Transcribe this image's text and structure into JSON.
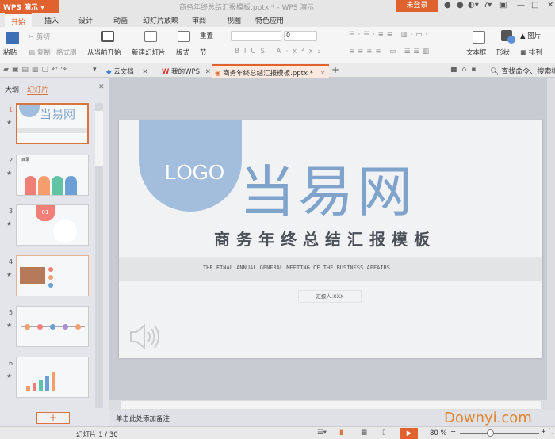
{
  "app": {
    "name": "WPS 演示",
    "doc_title": "商务年终总结汇报模板.pptx * - WPS 演示",
    "login": "未登录"
  },
  "menu_tabs": [
    "开始",
    "插入",
    "设计",
    "动画",
    "幻灯片放映",
    "审阅",
    "视图",
    "特色应用"
  ],
  "ribbon": {
    "paste": "粘贴",
    "cut": "剪切",
    "copy": "复制",
    "format_painter": "格式刷",
    "from_current": "从当前开始",
    "new_slide": "新建幻灯片",
    "layout": "版式",
    "reset": "重置",
    "section": "节",
    "font_size": "0",
    "textbox": "文本框",
    "shape": "形状",
    "picture": "图片",
    "arrange": "排列"
  },
  "doc_tabs": [
    "云文档",
    "我的WPS",
    "商务年终总结汇报模板.pptx *"
  ],
  "search_placeholder": "查找命令、搜索模板",
  "panel": {
    "outline_tab": "大纲",
    "slides_tab": "幻灯片",
    "add": "+"
  },
  "thumbnails": [
    {
      "num": "1",
      "title": "当易网"
    },
    {
      "num": "2",
      "title": "目录"
    },
    {
      "num": "3",
      "title": "01"
    },
    {
      "num": "4"
    },
    {
      "num": "5"
    },
    {
      "num": "6"
    }
  ],
  "slide": {
    "logo": "LOGO",
    "brand": "当易网",
    "title": "商务年终总结汇报模板",
    "subtitle": "THE FINAL ANNUAL GENERAL MEETING OF THE BUSINESS AFFAIRS",
    "reporter": "汇报人:XXX"
  },
  "notes_placeholder": "单击此处添加备注",
  "status": {
    "slide_count": "幻灯片 1 / 30",
    "zoom": "80 %",
    "watermark": "Downyi.com"
  },
  "colors": {
    "accent": "#e0622f",
    "slide_blue": "#7fa3cb",
    "logo_blue": "#a3bedc"
  }
}
